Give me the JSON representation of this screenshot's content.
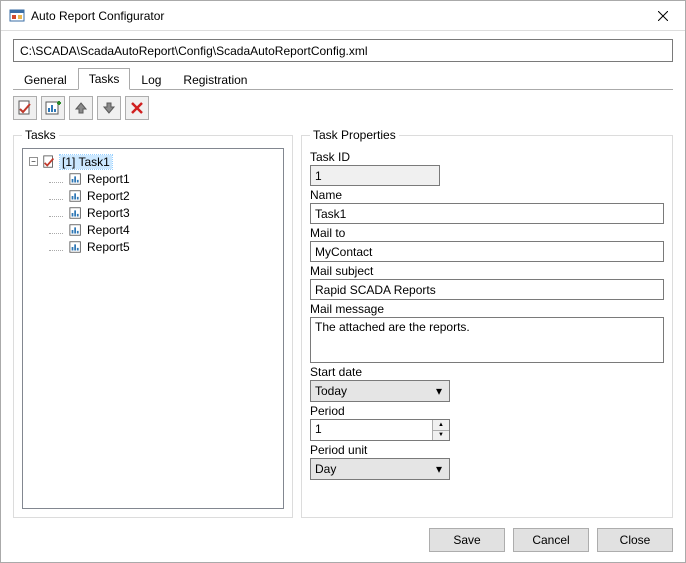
{
  "window": {
    "title": "Auto Report Configurator"
  },
  "path": "C:\\SCADA\\ScadaAutoReport\\Config\\ScadaAutoReportConfig.xml",
  "tabs": [
    {
      "label": "General",
      "active": false
    },
    {
      "label": "Tasks",
      "active": true
    },
    {
      "label": "Log",
      "active": false
    },
    {
      "label": "Registration",
      "active": false
    }
  ],
  "groups": {
    "tasks": "Tasks",
    "props": "Task Properties"
  },
  "tree": {
    "task_label": "[1] Task1",
    "reports": [
      "Report1",
      "Report2",
      "Report3",
      "Report4",
      "Report5"
    ]
  },
  "labels": {
    "task_id": "Task ID",
    "name": "Name",
    "mail_to": "Mail to",
    "mail_subject": "Mail subject",
    "mail_message": "Mail message",
    "start_date": "Start date",
    "period": "Period",
    "period_unit": "Period unit"
  },
  "values": {
    "task_id": "1",
    "name": "Task1",
    "mail_to": "MyContact",
    "mail_subject": "Rapid SCADA Reports",
    "mail_message": "The attached are the reports.",
    "start_date": "Today",
    "period": "1",
    "period_unit": "Day"
  },
  "buttons": {
    "save": "Save",
    "cancel": "Cancel",
    "close": "Close"
  }
}
